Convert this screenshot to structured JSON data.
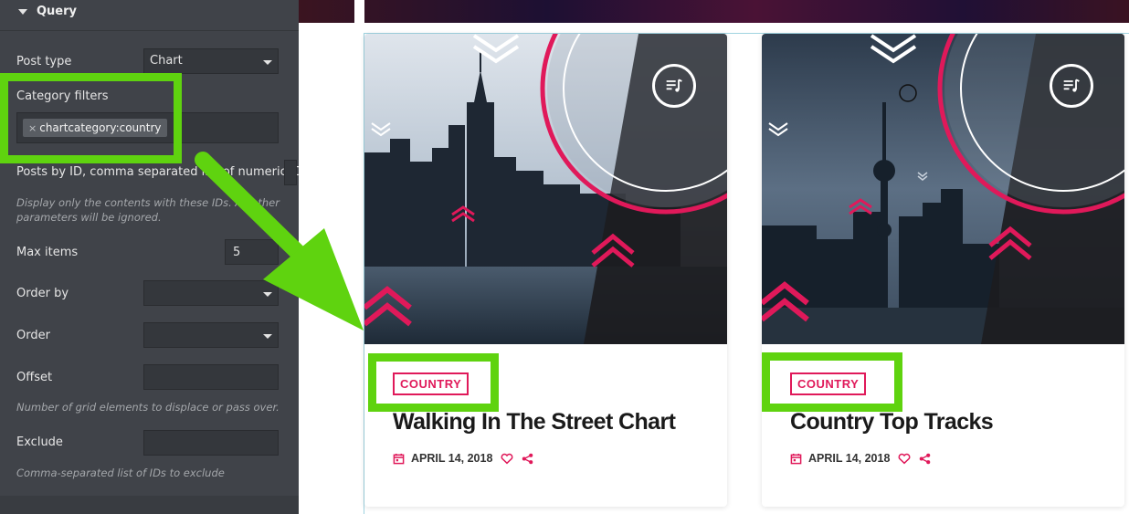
{
  "panel": {
    "section_title": "Query",
    "post_type": {
      "label": "Post type",
      "value": "Chart"
    },
    "category_filters": {
      "label": "Category filters",
      "tags": [
        "chartcategory:country"
      ]
    },
    "posts_by_id": {
      "label": "Posts by ID, comma separated list of numeric IDs",
      "help": "Display only the contents with these IDs. All other parameters will be ignored."
    },
    "max_items": {
      "label": "Max items",
      "value": "5"
    },
    "order_by": {
      "label": "Order by",
      "value": ""
    },
    "order": {
      "label": "Order",
      "value": ""
    },
    "offset": {
      "label": "Offset",
      "value": "",
      "help": "Number of grid elements to displace or pass over."
    },
    "exclude": {
      "label": "Exclude",
      "value": "",
      "help": "Comma-separated list of IDs to exclude"
    }
  },
  "cards": [
    {
      "category": "COUNTRY",
      "title": "Walking In The Street Chart",
      "date": "APRIL 14, 2018"
    },
    {
      "category": "COUNTRY",
      "title": "Country Top Tracks",
      "date": "APRIL 14, 2018"
    }
  ],
  "colors": {
    "accent": "#e0195a",
    "highlight": "#5fd30f",
    "panel_bg": "#404349"
  }
}
